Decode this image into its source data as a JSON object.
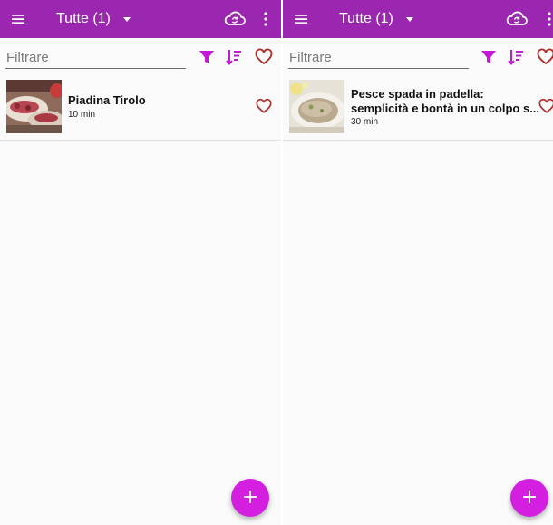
{
  "colors": {
    "primary": "#9b27b0",
    "accent": "#d41ee0",
    "heart": "#c0392b"
  },
  "icons": {
    "menu": "hamburger-menu-icon",
    "dropdown": "arrow-drop-down-icon",
    "sync": "cloud-sync-icon",
    "more": "more-vert-icon",
    "filter": "filter-funnel-icon",
    "sort": "sort-icon",
    "favorite": "heart-outline-icon",
    "add": "plus-icon"
  },
  "left": {
    "appbar": {
      "title": "Tutte (1)"
    },
    "filter": {
      "placeholder": "Filtrare"
    },
    "items": [
      {
        "title": "Piadina Tirolo",
        "time": "10 min"
      }
    ],
    "fab_label": "+"
  },
  "right": {
    "appbar": {
      "title": "Tutte (1)"
    },
    "filter": {
      "placeholder": "Filtrare"
    },
    "items": [
      {
        "title_line1": "Pesce spada in padella:",
        "title_line2": "semplicità e bontà in un colpo s...",
        "time": "30 min"
      }
    ],
    "fab_label": "+"
  }
}
